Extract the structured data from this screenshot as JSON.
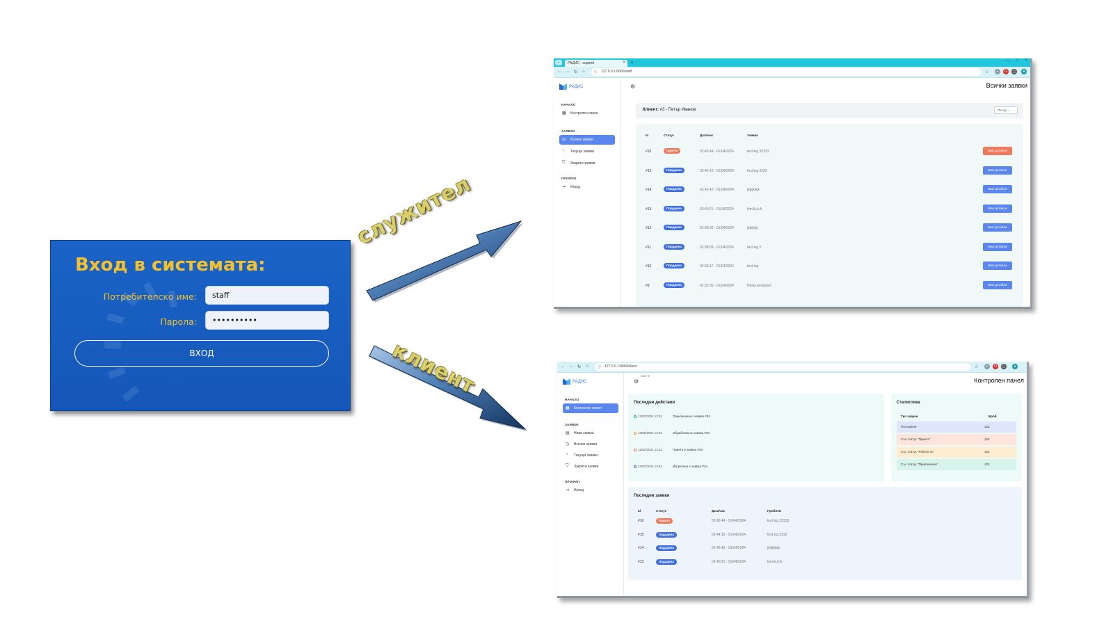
{
  "login": {
    "title": "Вход в системата:",
    "username_label": "Потребителско име:",
    "username_value": "staff",
    "password_label": "Парола:",
    "password_value": "••••••••••",
    "submit_label": "ВХОД"
  },
  "arrows": {
    "staff_label": "служител",
    "client_label": "клиент"
  },
  "staff_screen": {
    "tab_title": "РАДИС - support",
    "url": "127.0.0.1:8000/staff",
    "brand": "РАДИС",
    "page_title": "Всички заявки",
    "sidebar": {
      "sections": [
        "НАЧАЛО",
        "ЗАЯВКИ",
        "ПРОФИЛ"
      ],
      "items": [
        {
          "label": "Контролен панел"
        },
        {
          "label": "Всички заявки"
        },
        {
          "label": "Текущи заявки"
        },
        {
          "label": "Закрити заявки"
        },
        {
          "label": "Изход"
        }
      ]
    },
    "client_filter": {
      "label": "Клиент:",
      "value": "#3 - Петър Иванов",
      "select": "Петър"
    },
    "table": {
      "headers": [
        "Id",
        "Статус",
        "Дата/час",
        "Заявка"
      ],
      "detail_label": "Виж детайли",
      "rows": [
        {
          "id": "#16",
          "status": "Приета",
          "datetime": "02:45:44 - 01/04/2024",
          "request": "test log 33333"
        },
        {
          "id": "#15",
          "status": "Подадена",
          "datetime": "02:44:15 - 01/04/2024",
          "request": "test log 2222"
        },
        {
          "id": "#14",
          "status": "Подадена",
          "datetime": "02:42:42 - 01/04/2024",
          "request": "jkjkjkjkjk"
        },
        {
          "id": "#13",
          "status": "Подадена",
          "datetime": "02:40:21 - 01/04/2024",
          "request": "klm,lk,k.lk"
        },
        {
          "id": "#12",
          "status": "Подадена",
          "datetime": "02:39:30 - 01/04/2024",
          "request": "jkjkjkjkj"
        },
        {
          "id": "#11",
          "status": "Подадена",
          "datetime": "02:38:09 - 01/04/2024",
          "request": "test log 2"
        },
        {
          "id": "#10",
          "status": "Подадена",
          "datetime": "02:33:17 - 01/04/2024",
          "request": "test log"
        },
        {
          "id": "#9",
          "status": "Подадена",
          "datetime": "02:31:00 - 01/04/2024",
          "request": "Няма интернет"
        }
      ]
    }
  },
  "client_screen": {
    "url": "127.0.0.1:8000/client",
    "brand": "РАДИС",
    "user": "user 3",
    "page_title": "Контролен панел",
    "sidebar": {
      "sections": [
        "НАЧАЛО",
        "ЗАЯВКИ",
        "ПРОФИЛ"
      ],
      "items": [
        {
          "label": "Контролен панел"
        },
        {
          "label": "Нова заявка"
        },
        {
          "label": "Всички заявки"
        },
        {
          "label": "Текущи заявки"
        },
        {
          "label": "Закрити заявки"
        },
        {
          "label": "Изход"
        }
      ]
    },
    "recent_actions": {
      "title": "Последни действия",
      "items": [
        {
          "time": "12/02/2024 12:51",
          "text": "Приключена e заявка #34"
        },
        {
          "time": "12/02/2024 12:51",
          "text": "Обработва се заявка #34"
        },
        {
          "time": "12/02/2024 12:51",
          "text": "Приета е заявка #34"
        },
        {
          "time": "12/02/2024 12:51",
          "text": "Изпратена е заявка #34"
        }
      ]
    },
    "stats": {
      "title": "Статистика",
      "headers": [
        "Тип задачи",
        "Брой"
      ],
      "rows": [
        {
          "label": "Поставени",
          "count": "123",
          "color": "#dfe6fb"
        },
        {
          "label": "Със статус \"Приета\"",
          "count": "123",
          "color": "#fde4dc"
        },
        {
          "label": "Със статус \"Работи се\"",
          "count": "123",
          "color": "#fdeed2"
        },
        {
          "label": "Със статус \"Приключена\"",
          "count": "123",
          "color": "#d7f3ea"
        }
      ]
    },
    "recent_requests": {
      "title": "Последни заявки",
      "headers": [
        "Id",
        "Статус",
        "Дата/час",
        "Проблем"
      ],
      "rows": [
        {
          "id": "#16",
          "status": "Приета",
          "datetime": "02:45:44 - 01/04/2024",
          "problem": "test log 33333"
        },
        {
          "id": "#15",
          "status": "Подадена",
          "datetime": "02:44:15 - 01/04/2024",
          "problem": "test log 2222"
        },
        {
          "id": "#14",
          "status": "Подадена",
          "datetime": "02:42:42 - 01/04/2024",
          "problem": "jkjkjkjkjk"
        },
        {
          "id": "#13",
          "status": "Подадена",
          "datetime": "02:40:21 - 01/04/2024",
          "problem": "klm,lk,k.lk"
        }
      ]
    }
  },
  "colors": {
    "login_bg": "#1a63c7",
    "login_accent": "#f4c12a",
    "status_accepted": "#f07a5c",
    "status_submitted": "#3f6fe0",
    "sidebar_active": "#5b86ee",
    "browser_chrome": "#22c7dd"
  }
}
